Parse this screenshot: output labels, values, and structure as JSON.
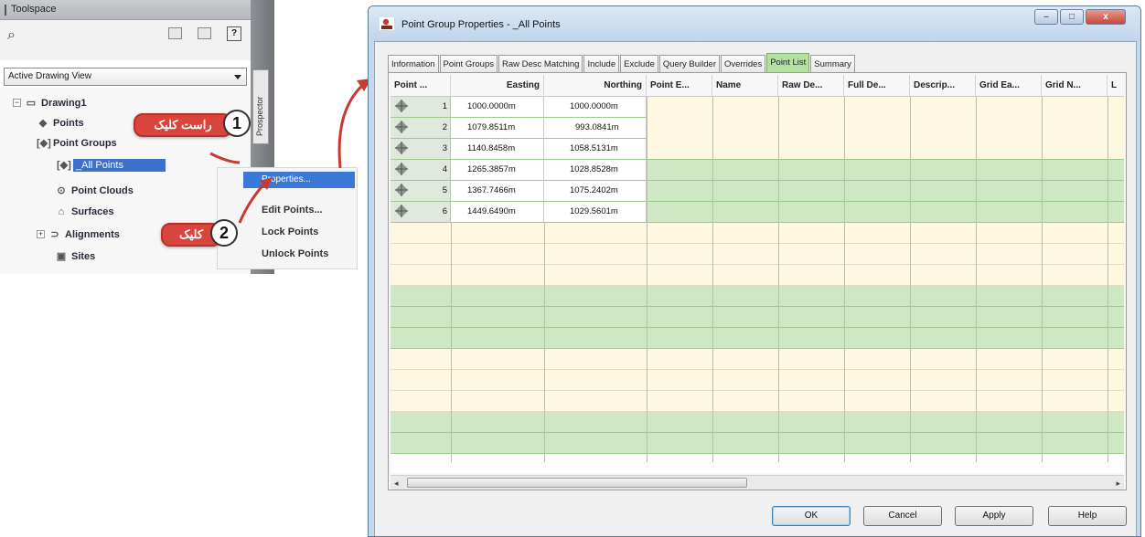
{
  "toolspace": {
    "title": "Toolspace",
    "view_select": "Active Drawing View",
    "side_tab": "Prospector",
    "help_label": "?",
    "tree": {
      "root": "Drawing1",
      "points": "Points",
      "point_groups": "Point Groups",
      "all_points": "_All Points",
      "point_clouds": "Point Clouds",
      "surfaces": "Surfaces",
      "alignments": "Alignments",
      "sites": "Sites"
    }
  },
  "context_menu": {
    "items": [
      "Properties...",
      "Edit Points...",
      "Lock Points",
      "Unlock Points"
    ]
  },
  "callouts": [
    {
      "number": "1",
      "text": "راست کلیک"
    },
    {
      "number": "2",
      "text": "کلیک"
    }
  ],
  "dialog": {
    "title": "Point Group Properties - _All Points",
    "tabs": [
      "Information",
      "Point Groups",
      "Raw Desc Matching",
      "Include",
      "Exclude",
      "Query Builder",
      "Overrides",
      "Point List",
      "Summary"
    ],
    "active_tab": "Point List",
    "columns": [
      "Point ...",
      "Easting",
      "Northing",
      "Point E...",
      "Name",
      "Raw De...",
      "Full De...",
      "Descrip...",
      "Grid Ea...",
      "Grid N...",
      "L"
    ],
    "rows": [
      {
        "number": "1",
        "easting": "1000.0000m",
        "northing": "1000.0000m"
      },
      {
        "number": "2",
        "easting": "1079.8511m",
        "northing": "993.0841m"
      },
      {
        "number": "3",
        "easting": "1140.8458m",
        "northing": "1058.5131m"
      },
      {
        "number": "4",
        "easting": "1265.3857m",
        "northing": "1028.8528m"
      },
      {
        "number": "5",
        "easting": "1367.7466m",
        "northing": "1075.2402m"
      },
      {
        "number": "6",
        "easting": "1449.6490m",
        "northing": "1029.5601m"
      }
    ],
    "buttons": {
      "ok": "OK",
      "cancel": "Cancel",
      "apply": "Apply",
      "help": "Help"
    },
    "window_controls": {
      "minimize": "–",
      "maximize": "□",
      "close": "x"
    }
  },
  "colors": {
    "callout_red": "#d9443c",
    "active_tab_green": "#b6e0a2",
    "row_green": "#cde8c2",
    "row_cream": "#fdf8df",
    "selection_blue": "#3b71c9"
  }
}
